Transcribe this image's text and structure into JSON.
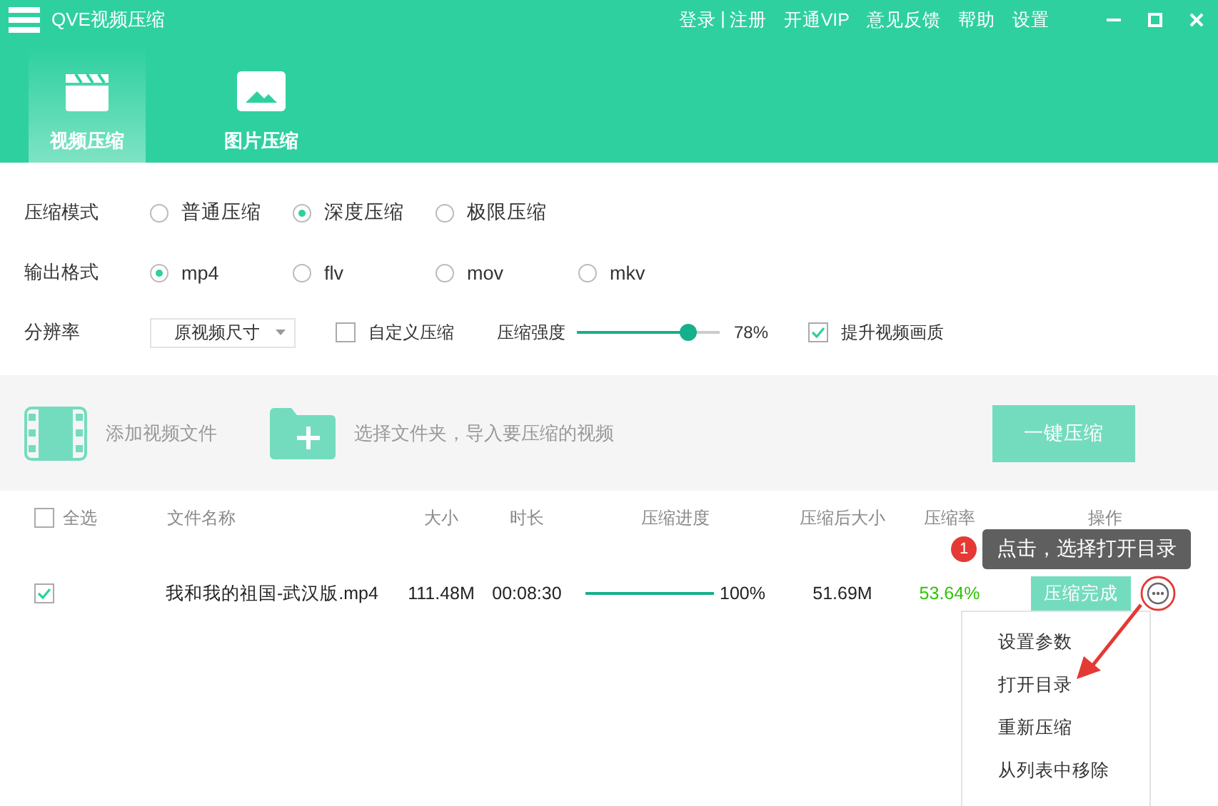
{
  "window": {
    "title": "QVE视频压缩"
  },
  "top_links": [
    {
      "label": "登录"
    },
    {
      "label": "|",
      "kind": "sep"
    },
    {
      "label": "注册"
    },
    {
      "label": "开通VIP"
    },
    {
      "label": "意见反馈"
    },
    {
      "label": "帮助"
    },
    {
      "label": "设置"
    }
  ],
  "tabs": [
    {
      "label": "视频压缩",
      "kind": "video",
      "selected": true
    },
    {
      "label": "图片压缩",
      "kind": "image",
      "selected": false
    }
  ],
  "compress_mode": {
    "label": "压缩模式",
    "options": [
      {
        "label": "普通压缩",
        "selected": false
      },
      {
        "label": "深度压缩",
        "selected": true
      },
      {
        "label": "极限压缩",
        "selected": false
      }
    ]
  },
  "output_format": {
    "label": "输出格式",
    "options": [
      {
        "label": "mp4",
        "selected": true
      },
      {
        "label": "flv",
        "selected": false
      },
      {
        "label": "mov",
        "selected": false
      },
      {
        "label": "mkv",
        "selected": false
      }
    ]
  },
  "resolution": {
    "label": "分辨率",
    "value": "原视频尺寸",
    "custom": {
      "label": "自定义压缩",
      "checked": false
    },
    "strength": {
      "label": "压缩强度",
      "level": 0.78,
      "reading": "78%"
    },
    "enhance": {
      "label": "提升视频画质",
      "checked": true
    }
  },
  "toolbar": {
    "add_file": "添加视频文件",
    "add_folder": "选择文件夹，导入要压缩的视频",
    "compress_button": "一键压缩"
  },
  "table": {
    "select_all": {
      "label": "全选",
      "checked": false
    },
    "columns": [
      "文件名称",
      "大小",
      "时长",
      "压缩进度",
      "压缩后大小",
      "压缩率",
      "操作"
    ],
    "rows": [
      {
        "checked": true,
        "name": "我和我的祖国-武汉版.mp4",
        "size": "111.48M",
        "duration": "00:08:30",
        "progress": {
          "level": 1,
          "reading": "100%"
        },
        "compressed_size": "51.69M",
        "ratio": "53.64%",
        "status": "压缩完成"
      }
    ]
  },
  "tooltip": {
    "badge": "1",
    "text": "点击，选择打开目录"
  },
  "context_menu": [
    "设置参数",
    "打开目录",
    "重新压缩",
    "从列表中移除"
  ]
}
